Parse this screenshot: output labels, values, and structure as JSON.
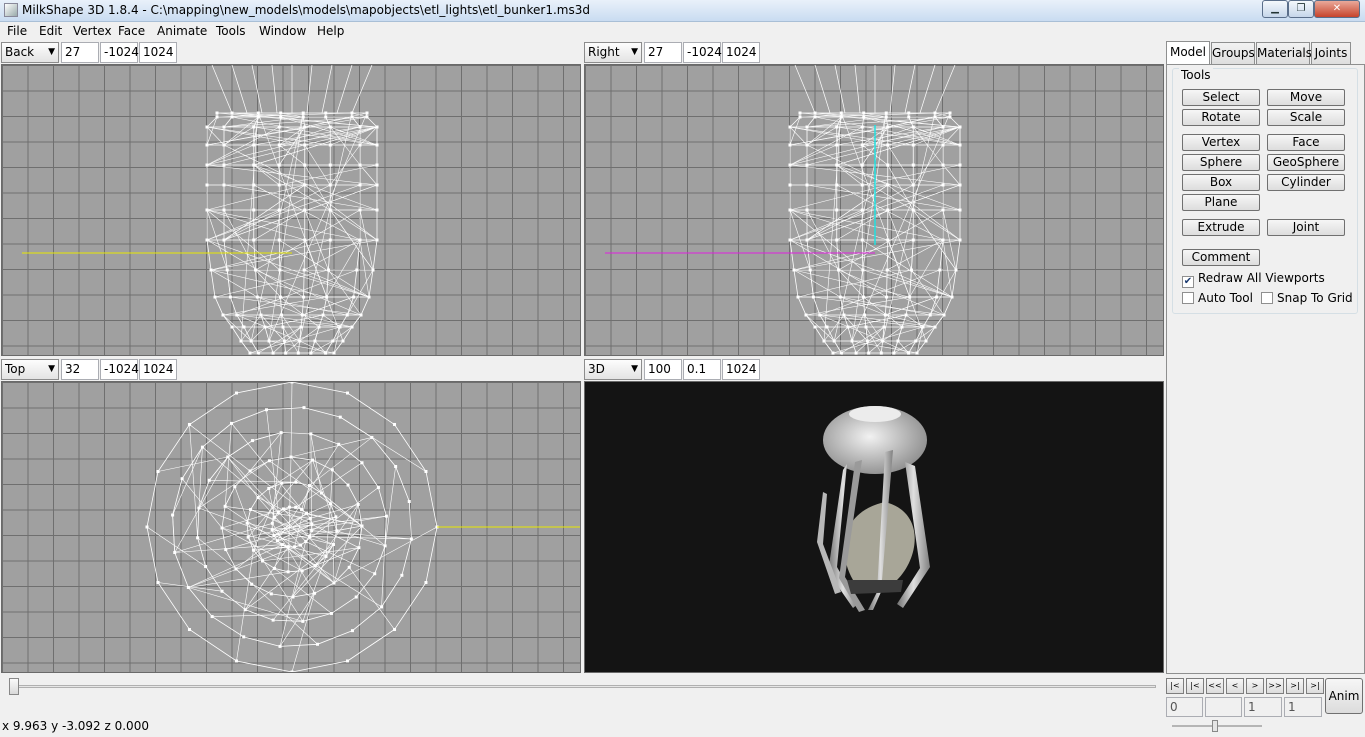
{
  "window": {
    "title": "MilkShape 3D 1.8.4 - C:\\mapping\\new_models\\models\\mapobjects\\etl_lights\\etl_bunker1.ms3d",
    "min_label": "▁",
    "max_label": "❐",
    "close_label": "✕"
  },
  "menu": [
    "File",
    "Edit",
    "Vertex",
    "Face",
    "Animate",
    "Tools",
    "Window",
    "Help"
  ],
  "viewports": {
    "back": {
      "view": "Back",
      "f1": "27",
      "f2": "-1024",
      "f3": "1024"
    },
    "right": {
      "view": "Right",
      "f1": "27",
      "f2": "-1024",
      "f3": "1024"
    },
    "top": {
      "view": "Top",
      "f1": "32",
      "f2": "-1024",
      "f3": "1024"
    },
    "persp": {
      "view": "3D",
      "f1": "100",
      "f2": "0.1",
      "f3": "1024"
    }
  },
  "colors": {
    "grid_bg": "#a0a0a0",
    "wire": "#ffffff",
    "axis_yellow": "#e8e800",
    "axis_magenta": "#e020e0",
    "axis_cyan": "#20e0e0",
    "persp_bg": "#141414"
  },
  "panel": {
    "tabs": [
      "Model",
      "Groups",
      "Materials",
      "Joints"
    ],
    "group_label": "Tools",
    "buttons": {
      "select": "Select",
      "move": "Move",
      "rotate": "Rotate",
      "scale": "Scale",
      "vertex": "Vertex",
      "face": "Face",
      "sphere": "Sphere",
      "geosphere": "GeoSphere",
      "box": "Box",
      "cylinder": "Cylinder",
      "plane": "Plane",
      "extrude": "Extrude",
      "joint": "Joint",
      "comment": "Comment"
    },
    "checks": {
      "redraw": {
        "label": "Redraw All Viewports",
        "checked": true
      },
      "autotool": {
        "label": "Auto Tool",
        "checked": false
      },
      "snap": {
        "label": "Snap To Grid",
        "checked": false
      }
    }
  },
  "playback": {
    "buttons": [
      "first-frame-icon",
      "prev-key-icon",
      "rewind-icon",
      "step-back-icon",
      "step-forward-icon",
      "fast-forward-icon",
      "next-key-icon",
      "last-frame-icon"
    ],
    "glyphs": [
      "|<",
      "|<",
      "<<",
      "<",
      ">",
      ">>",
      ">|",
      ">|"
    ],
    "frame_fields": [
      "0",
      "",
      "1",
      "1"
    ],
    "anim_label": "Anim"
  },
  "status": {
    "coords": "x 9.963 y -3.092 z 0.000"
  }
}
